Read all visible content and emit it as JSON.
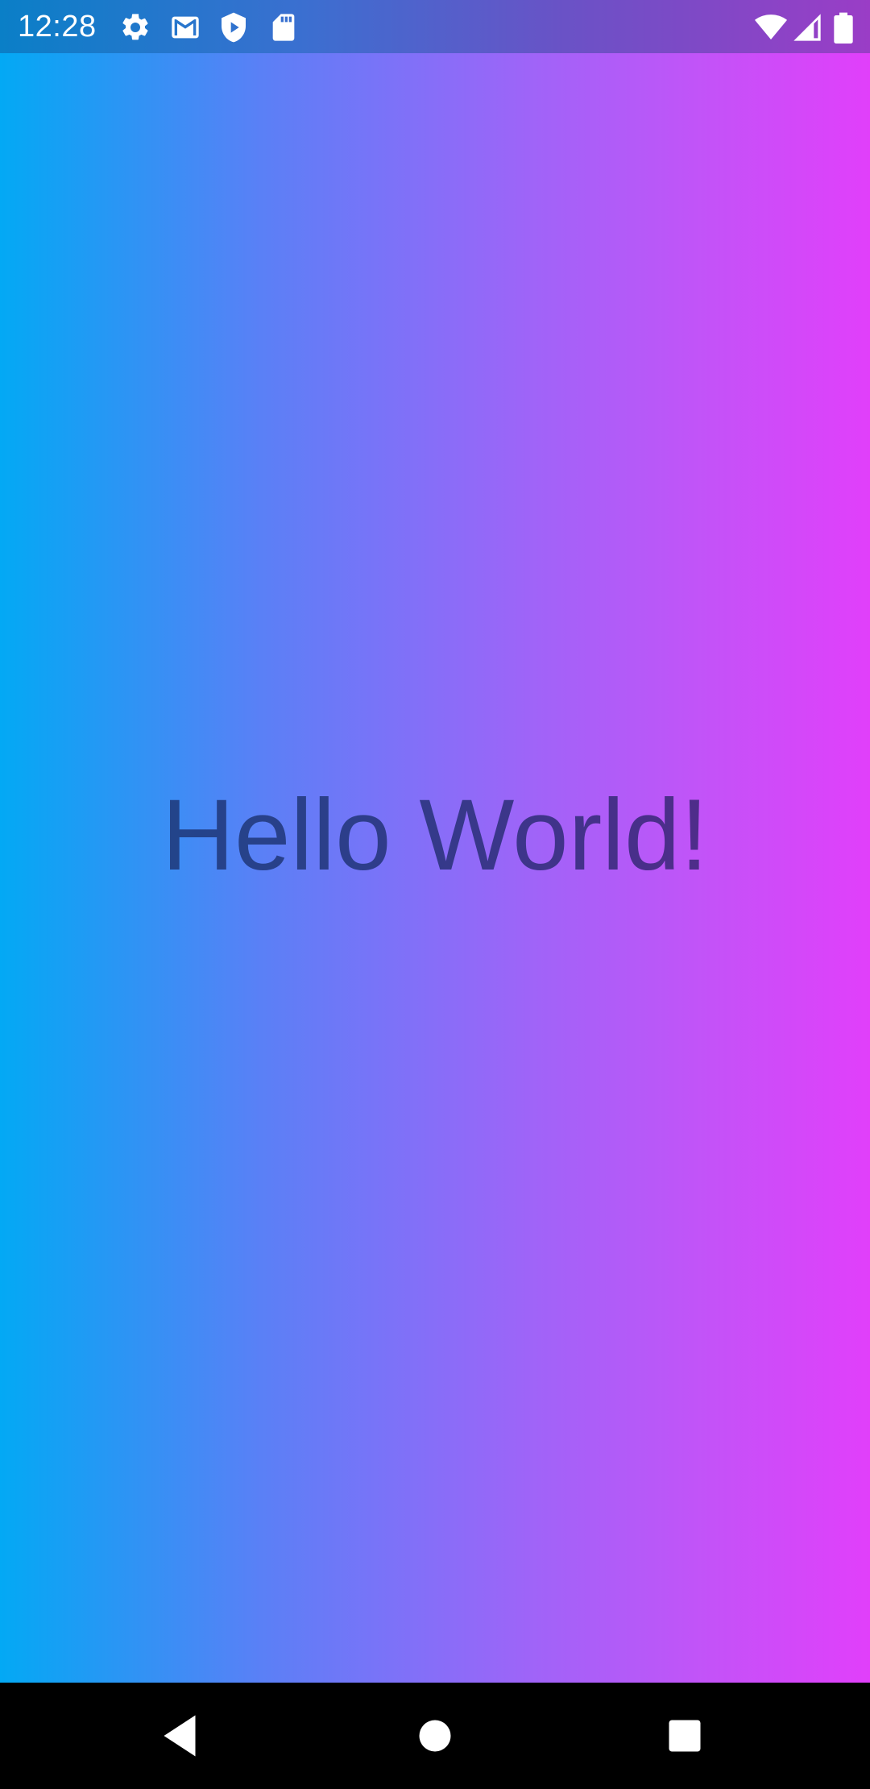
{
  "status_bar": {
    "time": "12:28",
    "left_icons": [
      "gear-icon",
      "gmail-icon",
      "shield-play-icon",
      "sd-card-icon"
    ],
    "right_icons": [
      "wifi-icon",
      "cell-signal-icon",
      "battery-icon"
    ]
  },
  "main": {
    "greeting": "Hello World!",
    "gradient_colors": [
      "#03a9f4",
      "#e13ffa"
    ]
  },
  "nav_bar": {
    "buttons": [
      "back-icon",
      "home-icon",
      "recents-icon"
    ]
  }
}
